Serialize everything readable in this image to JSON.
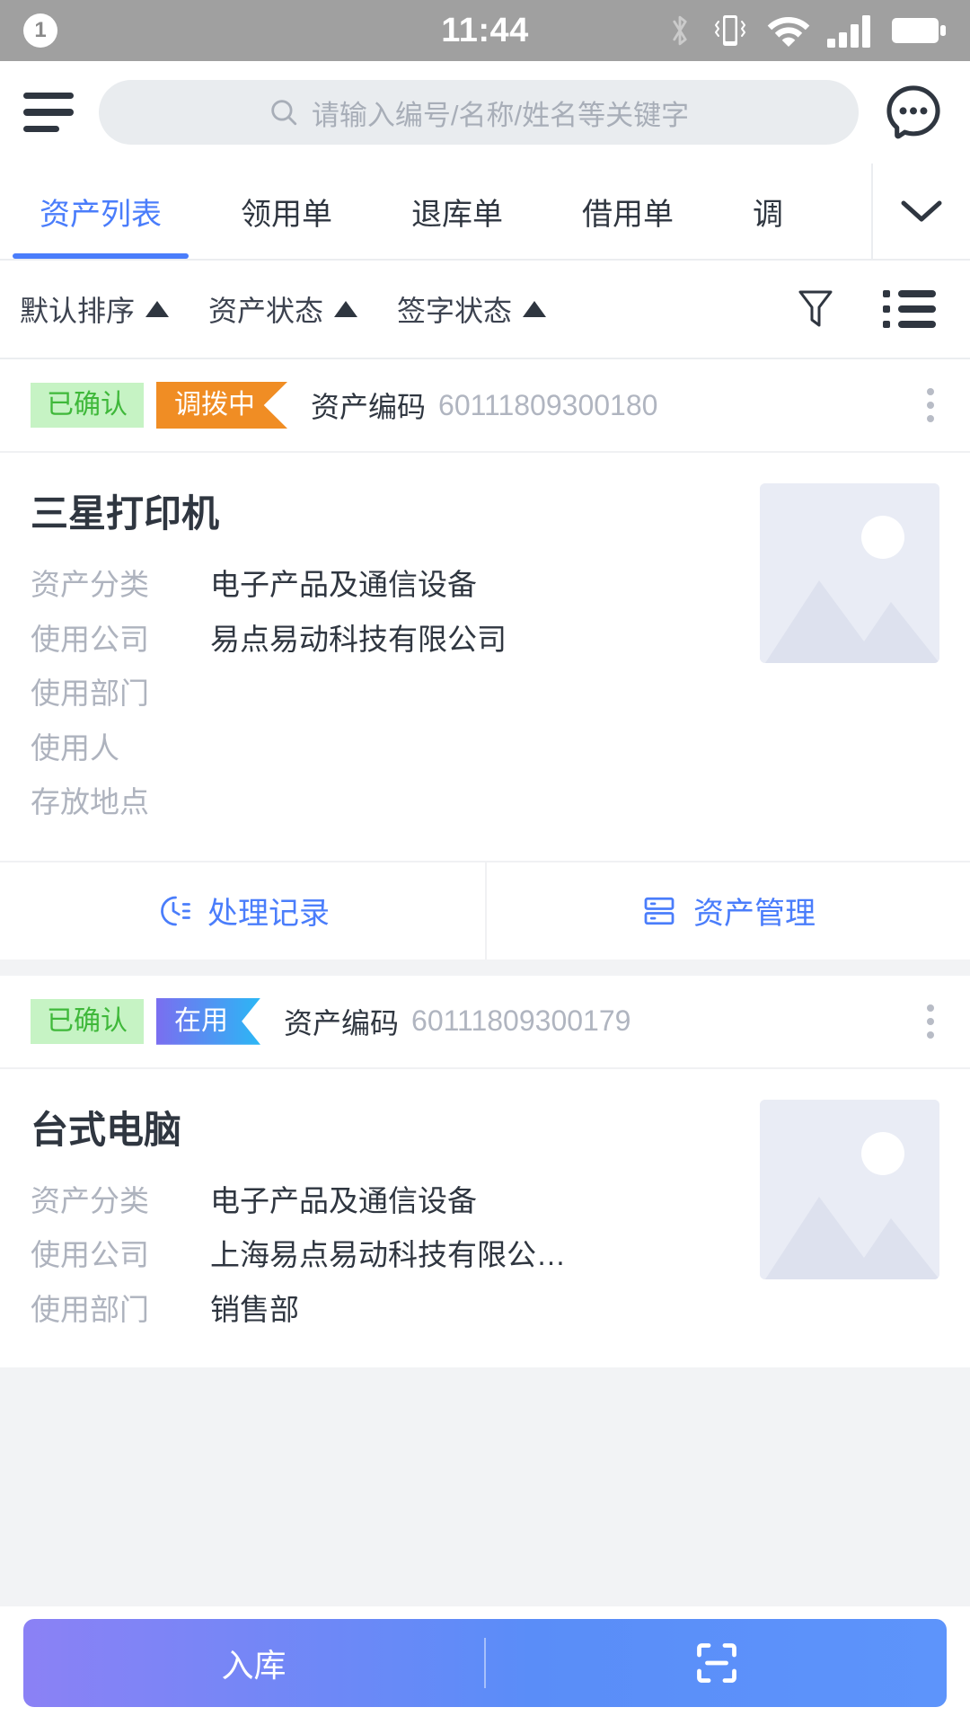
{
  "statusbar": {
    "notification_count": "1",
    "time": "11:44",
    "icons": [
      "bluetooth-icon",
      "vibrate-icon",
      "wifi-icon",
      "cellular-signal-icon",
      "battery-icon"
    ]
  },
  "header": {
    "menu_icon": "hamburger-menu-icon",
    "search_placeholder": "请输入编号/名称/姓名等关键字",
    "search_value": "",
    "chat_icon": "chat-bubble-icon"
  },
  "tabs": {
    "items": [
      {
        "label": "资产列表",
        "active": true
      },
      {
        "label": "领用单",
        "active": false
      },
      {
        "label": "退库单",
        "active": false
      },
      {
        "label": "借用单",
        "active": false
      },
      {
        "label": "调",
        "active": false
      }
    ],
    "expand_icon": "chevron-down-icon"
  },
  "filterbar": {
    "items": [
      {
        "label": "默认排序",
        "icon": "caret-up-icon"
      },
      {
        "label": "资产状态",
        "icon": "caret-up-icon"
      },
      {
        "label": "签字状态",
        "icon": "caret-up-icon"
      }
    ],
    "funnel_icon": "filter-funnel-icon",
    "list_icon": "list-view-icon"
  },
  "cards": [
    {
      "status_badge": "已确认",
      "state_badge": "调拨中",
      "state_color": "#f08d24",
      "code_label": "资产编码",
      "code_value": "60111809300180",
      "menu_icon": "kebab-menu-icon",
      "name": "三星打印机",
      "fields": [
        {
          "label": "资产分类",
          "value": "电子产品及通信设备"
        },
        {
          "label": "使用公司",
          "value": "易点易动科技有限公司"
        },
        {
          "label": "使用部门",
          "value": ""
        },
        {
          "label": "使用人",
          "value": ""
        },
        {
          "label": "存放地点",
          "value": ""
        }
      ],
      "thumb_icon": "image-placeholder-icon",
      "actions": [
        {
          "label": "处理记录",
          "icon": "history-record-icon"
        },
        {
          "label": "资产管理",
          "icon": "asset-management-icon"
        }
      ]
    },
    {
      "status_badge": "已确认",
      "state_badge": "在用",
      "state_color": "#2bb7f5",
      "code_label": "资产编码",
      "code_value": "60111809300179",
      "menu_icon": "kebab-menu-icon",
      "name": "台式电脑",
      "fields": [
        {
          "label": "资产分类",
          "value": "电子产品及通信设备"
        },
        {
          "label": "使用公司",
          "value": "上海易点易动科技有限公…"
        },
        {
          "label": "使用部门",
          "value": "销售部"
        }
      ],
      "thumb_icon": "image-placeholder-icon",
      "actions": []
    }
  ],
  "bottombar": {
    "primary_label": "入库",
    "scan_icon": "scan-code-icon",
    "accent_color": "#5a8df8"
  }
}
